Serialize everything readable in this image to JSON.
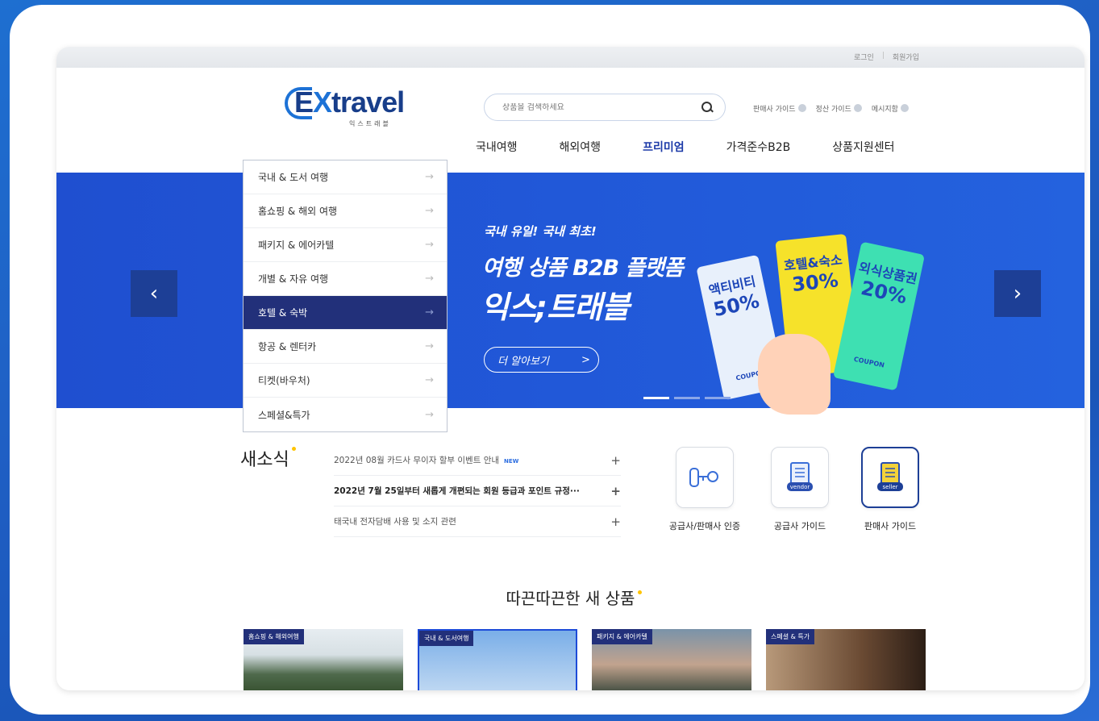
{
  "top_links": {
    "login": "로그인",
    "sep": "|",
    "signup": "회원가입"
  },
  "logo": {
    "main_prefix": "E",
    "main_x": "X",
    "main_rest": "travel",
    "sub": "익스트래블"
  },
  "search": {
    "placeholder": "상품을 검색하세요",
    "icon": "search-icon"
  },
  "guides": [
    "판매사 가이드",
    "정산 가이드",
    "메시지함"
  ],
  "gnb": {
    "items": [
      "국내여행",
      "해외여행",
      "프리미엄",
      "가격준수B2B",
      "상품지원센터"
    ],
    "active_index": 2
  },
  "category_menu": {
    "items": [
      "국내 & 도서 여행",
      "홈쇼핑 & 해외 여행",
      "패키지 & 에어카텔",
      "개별 & 자유 여행",
      "호텔 & 숙박",
      "항공 & 렌터카",
      "티켓(바우처)",
      "스페셜&특가"
    ],
    "selected_index": 4,
    "arrow": "→"
  },
  "banner": {
    "line1": "국내 유일! 국내 최초!",
    "line2": "여행 상품 B2B 플랫폼",
    "line3": "익스;트래블",
    "more": "더 알아보기",
    "more_arrow": ">",
    "prev": "‹",
    "next": "›",
    "coupons": [
      {
        "label": "액티비티",
        "value": "50%",
        "sub": "COUPON"
      },
      {
        "label": "호텔&숙소",
        "value": "30%"
      },
      {
        "label": "외식상품권",
        "value": "20%",
        "sub": "COUPON"
      }
    ],
    "slides_total": 3,
    "active_slide": 1
  },
  "news": {
    "title": "새소식",
    "items": [
      {
        "text": "2022년 08월 카드사 무이자 할부 이벤트 안내",
        "badge": "NEW",
        "bold": false
      },
      {
        "text": "2022년 7월 25일부터 새롭게 개편되는 회원 등급과 포인트 규정···",
        "badge": "",
        "bold": true
      },
      {
        "text": "태국내 전자담배 사용 및 소지 관련",
        "badge": "",
        "bold": false
      }
    ],
    "plus": "+"
  },
  "quick_links": [
    {
      "label": "공급사/판매사 인증",
      "icon": "key-icon",
      "icon_text": ""
    },
    {
      "label": "공급사 가이드",
      "icon": "vendor-doc-icon",
      "icon_text": "vendor"
    },
    {
      "label": "판매사 가이드",
      "icon": "seller-doc-icon",
      "icon_text": "seller"
    }
  ],
  "new_products": {
    "title": "따끈따끈한 새 상품",
    "cards": [
      {
        "tag": "홈쇼핑 & 해외여행"
      },
      {
        "tag": "국내 & 도서여행"
      },
      {
        "tag": "패키지 & 에어카텔"
      },
      {
        "tag": "스페셜 & 특가"
      }
    ]
  },
  "colors": {
    "brand": "#1c3aa8",
    "banner": "#2158d8",
    "menu_selected": "#22307a",
    "accent_dot": "#ffc400"
  }
}
